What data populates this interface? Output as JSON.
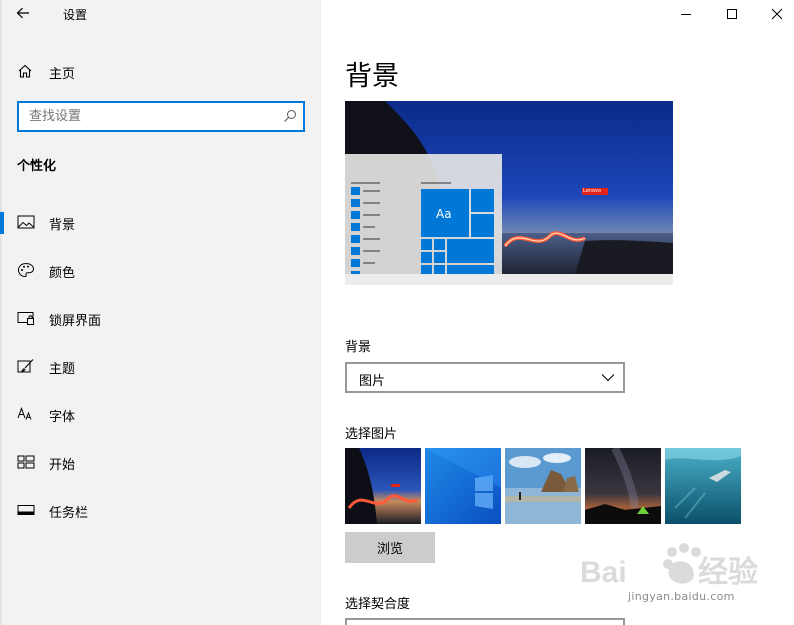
{
  "window": {
    "title": "设置",
    "controls": [
      "minimize",
      "maximize",
      "close"
    ]
  },
  "sidebar": {
    "home_label": "主页",
    "search_placeholder": "查找设置",
    "section_title": "个性化",
    "items": [
      {
        "label": "背景",
        "icon": "picture-icon",
        "active": true
      },
      {
        "label": "颜色",
        "icon": "palette-icon",
        "active": false
      },
      {
        "label": "锁屏界面",
        "icon": "lock-screen-icon",
        "active": false
      },
      {
        "label": "主题",
        "icon": "theme-brush-icon",
        "active": false
      },
      {
        "label": "字体",
        "icon": "font-icon",
        "active": false
      },
      {
        "label": "开始",
        "icon": "start-grid-icon",
        "active": false
      },
      {
        "label": "任务栏",
        "icon": "taskbar-icon",
        "active": false
      }
    ]
  },
  "main": {
    "page_title": "背景",
    "preview": {
      "sample_text": "Aa",
      "brand_tag": "Lenovo"
    },
    "background_label": "背景",
    "background_value": "图片",
    "choose_picture_label": "选择图片",
    "thumbnails": [
      "lenovo-beach-light",
      "windows-blue",
      "rock-beach",
      "night-sky-tent",
      "underwater-swimmer"
    ],
    "browse_label": "浏览",
    "fit_label": "选择契合度"
  },
  "watermark": {
    "text": "jingyan.baidu.com"
  },
  "colors": {
    "accent": "#0078d7",
    "sidebar_bg": "#f2f2f2",
    "button_bg": "#cccccc"
  }
}
